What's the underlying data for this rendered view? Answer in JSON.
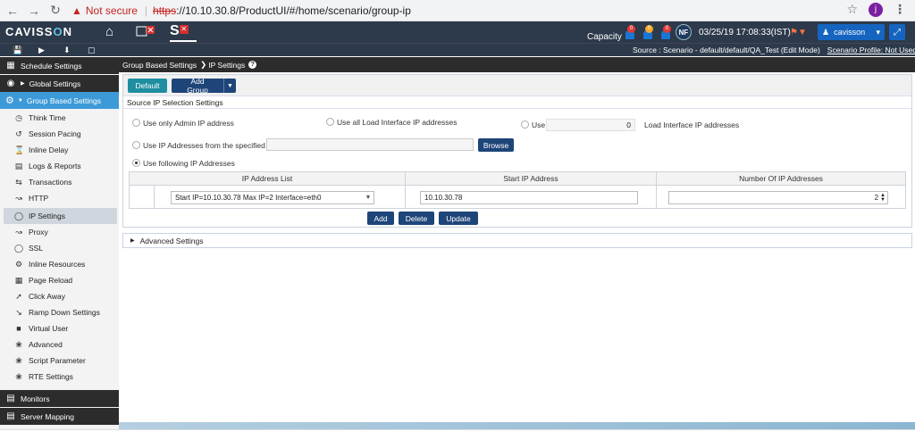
{
  "browser": {
    "not_secure": "Not secure",
    "scheme": "https",
    "url_rest": "://10.10.30.8/ProductUI/#/home/scenario/group-ip",
    "profile_initial": "j"
  },
  "header": {
    "logo_a": "CAVISS",
    "logo_o": "O",
    "logo_b": "N",
    "capacity": "Capacity",
    "badges": [
      "0",
      "0",
      "0"
    ],
    "nf": "NF",
    "datetime": "03/25/19 17:08:33(IST)",
    "user": "cavisson"
  },
  "toolbar": {
    "source": "Source : Scenario - default/default/QA_Test (Edit Mode)",
    "profile": "Scenario Profile: Not Used"
  },
  "sidebar": {
    "schedule": "Schedule Settings",
    "global": "Global Settings",
    "group": "Group Based Settings",
    "items": [
      {
        "label": "Think Time",
        "icon": "clock-icon"
      },
      {
        "label": "Session Pacing",
        "icon": "history-icon"
      },
      {
        "label": "Inline Delay",
        "icon": "hourglass-icon"
      },
      {
        "label": "Logs & Reports",
        "icon": "document-icon"
      },
      {
        "label": "Transactions",
        "icon": "transfer-icon"
      },
      {
        "label": "HTTP",
        "icon": "http-icon"
      },
      {
        "label": "IP Settings",
        "icon": "shield-icon"
      },
      {
        "label": "Proxy",
        "icon": "proxy-icon"
      },
      {
        "label": "SSL",
        "icon": "ssl-icon"
      },
      {
        "label": "Inline Resources",
        "icon": "gear-icon"
      },
      {
        "label": "Page Reload",
        "icon": "reload-icon"
      },
      {
        "label": "Click Away",
        "icon": "pointer-icon"
      },
      {
        "label": "Ramp Down Settings",
        "icon": "ramp-down-icon"
      },
      {
        "label": "Virtual User",
        "icon": "user-icon"
      },
      {
        "label": "Advanced",
        "icon": "advanced-icon"
      },
      {
        "label": "Script Parameter",
        "icon": "script-icon"
      },
      {
        "label": "RTE Settings",
        "icon": "rte-icon"
      }
    ],
    "monitors": "Monitors",
    "server_mapping": "Server Mapping"
  },
  "breadcrumb": {
    "parent": "Group Based Settings",
    "current": "IP Settings"
  },
  "panel": {
    "default_btn": "Default",
    "add_group_btn": "Add Group",
    "source_section": "Source IP Selection Settings",
    "opt_admin": "Use only Admin IP address",
    "opt_all_load": "Use all Load Interface IP addresses",
    "opt_use": "Use",
    "use_count": "0",
    "opt_use_suffix": "Load Interface IP addresses",
    "opt_file": "Use IP Addresses from the specified file",
    "browse_btn": "Browse",
    "opt_following": "Use following IP Addresses",
    "table": {
      "headers": [
        "IP Address List",
        "Start IP Address",
        "Number Of IP Addresses"
      ],
      "row": {
        "ip_list": "Start IP=10.10.30.78 Max IP=2 Interface=eth0",
        "start_ip": "10.10.30.78",
        "count": "2"
      }
    },
    "add_btn": "Add",
    "delete_btn": "Delete",
    "update_btn": "Update"
  },
  "advanced": "Advanced Settings"
}
